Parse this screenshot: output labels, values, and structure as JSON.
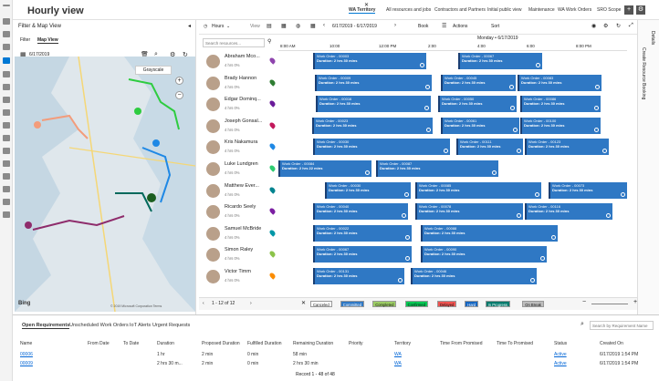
{
  "app": {
    "title": "Hourly view"
  },
  "tabs": [
    "WA Territory",
    "All resources and jobs",
    "Contractors and Partners",
    "Initial public view",
    "Maintenance",
    "WA Work Orders",
    "SRO Scope"
  ],
  "filter": {
    "title": "Filter & Map View",
    "tab_filter": "Filter",
    "tab_map": "Map View",
    "date": "6/17/2019",
    "grayscale": "Grayscale",
    "bing": "Bing",
    "copyright": "© 2019 Microsoft Corporation Terms"
  },
  "toolbar": {
    "hours": "Hours",
    "view": "View",
    "date": "6/17/2019 - 6/17/2019",
    "book": "Book",
    "actions": "Actions",
    "sort": "Sort",
    "search_placeholder": "Search resources..."
  },
  "timeline": {
    "day": "Monday • 6/17/2019",
    "hours": [
      "8:00 AM",
      "10:00",
      "12:00 PM",
      "2:00",
      "4:00",
      "6:00",
      "8:00 PM"
    ]
  },
  "resources": [
    {
      "name": "Abraham Mco...",
      "sub": "4 hrs 0%",
      "pin": "#8e44ad"
    },
    {
      "name": "Brady Hannon",
      "sub": "4 hrs 0%",
      "pin": "#2e7d32"
    },
    {
      "name": "Edgar Dominq...",
      "sub": "4 hrs 0%",
      "pin": "#6a1b9a"
    },
    {
      "name": "Joseph Gonsal...",
      "sub": "4 hrs 0%",
      "pin": "#c2185b"
    },
    {
      "name": "Kris Nakamura",
      "sub": "4 hrs 0%",
      "pin": "#1e88e5"
    },
    {
      "name": "Luke Lundgren",
      "sub": "4 hrs 0%",
      "pin": "#2ecc71"
    },
    {
      "name": "Matthew Ever...",
      "sub": "4 hrs 0%",
      "pin": "#00838f"
    },
    {
      "name": "Ricardo Seely",
      "sub": "4 hrs 0%",
      "pin": "#7b1fa2"
    },
    {
      "name": "Samuel McBride",
      "sub": "4 hrs 0%",
      "pin": "#0097a7"
    },
    {
      "name": "Simon Raley",
      "sub": "4 hrs 0%",
      "pin": "#8bc34a"
    },
    {
      "name": "Victor Timm",
      "sub": "4 hrs 0%",
      "pin": "#fb8c00"
    }
  ],
  "schedule": [
    [
      {
        "t": "Work Order - 00003",
        "d": "Duration: 2 hrs 30 mins"
      },
      {
        "t": "Work Order - 00067",
        "d": "Duration: 2 hrs 30 mins"
      },
      {
        "t": "Work Order - 00105",
        "d": "Duration: 2 hrs 30 mins"
      }
    ],
    [
      {
        "t": "Work Order - 00009",
        "d": "Duration: 2 hrs 30 mins"
      },
      {
        "t": "Work Order - 00045",
        "d": "Duration: 2 hrs 30 mins"
      },
      {
        "t": "Work Order - 00083",
        "d": "Duration: 2 hrs 30 mins"
      }
    ],
    [
      {
        "t": "Work Order - 00016",
        "d": "Duration: 2 hrs 30 mins"
      },
      {
        "t": "Work Order - 00050",
        "d": "Duration: 2 hrs 30 mins"
      },
      {
        "t": "Work Order - 00086",
        "d": "Duration: 2 hrs 30 mins"
      }
    ],
    [
      {
        "t": "Work Order - 00023",
        "d": "Duration: 2 hrs 30 mins"
      },
      {
        "t": "Work Order - 00061",
        "d": "Duration: 2 hrs 30 mins"
      },
      {
        "t": "Work Order - 00100",
        "d": "Duration: 2 hrs 30 mins"
      }
    ],
    [
      {
        "t": "Work Order - 00030",
        "d": "Duration: 2 hrs 30 mins"
      },
      {
        "t": "Work Order - 00111",
        "d": "Duration: 2 hrs 30 mins"
      },
      {
        "t": "Work Order - 00123",
        "d": "Duration: 2 hrs 30 mins"
      }
    ],
    [
      {
        "t": "Work Order - 00084",
        "d": "Duration: 2 hrs 22 mins"
      },
      {
        "t": "Work Order - 00087",
        "d": "Duration: 2 hrs 30 mins"
      },
      {
        "t": "Work Order - 00112",
        "d": "Duration: 2 hrs 30 mins"
      }
    ],
    [
      {
        "t": "Work Order - 00030",
        "d": "Duration: 2 hrs 30 mins"
      },
      {
        "t": "Work Order - 00085",
        "d": "Duration: 2 hrs 30 mins"
      },
      {
        "t": "Work Order - 00073",
        "d": "Duration: 2 hrs 30 mins"
      }
    ],
    [
      {
        "t": "Work Order - 00040",
        "d": "Duration: 2 hrs 30 mins"
      },
      {
        "t": "Work Order - 00078",
        "d": "Duration: 2 hrs 30 mins"
      },
      {
        "t": "Work Order - 00116",
        "d": "Duration: 2 hrs 30 mins"
      }
    ],
    [
      {
        "t": "Work Order - 00022",
        "d": "Duration: 2 hrs 30 mins"
      },
      {
        "t": "Work Order - 00088",
        "d": "Duration: 2 hrs 30 mins"
      },
      {
        "t": "Work Order - 00077",
        "d": "Duration: 2 hrs 30 mins"
      }
    ],
    [
      {
        "t": "Work Order - 00067",
        "d": "Duration: 2 hrs 30 mins"
      },
      {
        "t": "Work Order - 00090",
        "d": "Duration: 2 hrs 30 mins"
      },
      {
        "t": "Work Order - 00101",
        "d": "Duration: 2 hrs 30 mins"
      }
    ],
    [
      {
        "t": "Work Order - 00131",
        "d": "Duration: 2 hrs 30 mins"
      },
      {
        "t": "Work Order - 00046",
        "d": "Duration: 2 hrs 30 mins"
      },
      {
        "t": "Work Order - 00118",
        "d": "Duration: 2 hrs 30 mins"
      }
    ]
  ],
  "travel": [
    "33m",
    "33m",
    "19m",
    "28m",
    "13m",
    "13m",
    "20m"
  ],
  "pager": "1 - 12 of 12",
  "legend": [
    {
      "label": "Canceled",
      "color": "#ffffff"
    },
    {
      "label": "Committed",
      "color": "#2f78c4"
    },
    {
      "label": "Completed",
      "color": "#9ccc65"
    },
    {
      "label": "Confirmed",
      "color": "#00c853"
    },
    {
      "label": "Delayed",
      "color": "#ef5350"
    },
    {
      "label": "Hard",
      "color": "#1565c0"
    },
    {
      "label": "In Progress",
      "color": "#00796b"
    },
    {
      "label": "On Break",
      "color": "#bdbdbd"
    }
  ],
  "right_panel": {
    "label": "Create Resource Booking",
    "details": "Details"
  },
  "bottom": {
    "tabs": [
      "Open Requirements",
      "Unscheduled Work Orders",
      "IoT Alerts",
      "Urgent Requests"
    ],
    "search_placeholder": "Search by Requirement Name",
    "columns": [
      "Name",
      "From Date",
      "To Date",
      "Duration",
      "Proposed Duration",
      "Fulfilled Duration",
      "Remaining Duration",
      "Priority",
      "Territory",
      "Time From Promised",
      "Time To Promised",
      "Status",
      "Created On"
    ],
    "rows": [
      [
        "00006",
        "",
        "",
        "1 hr",
        "2 min",
        "0 min",
        "58 min",
        "",
        "WA",
        "",
        "",
        "Active",
        "6/17/2019 1:54 PM"
      ],
      [
        "00009",
        "",
        "",
        "2 hrs 30 m...",
        "2 min",
        "0 min",
        "2 hrs 30 min",
        "",
        "WA",
        "",
        "",
        "Active",
        "6/17/2019 1:54 PM"
      ]
    ],
    "record": "Record 1 - 48 of 48"
  }
}
